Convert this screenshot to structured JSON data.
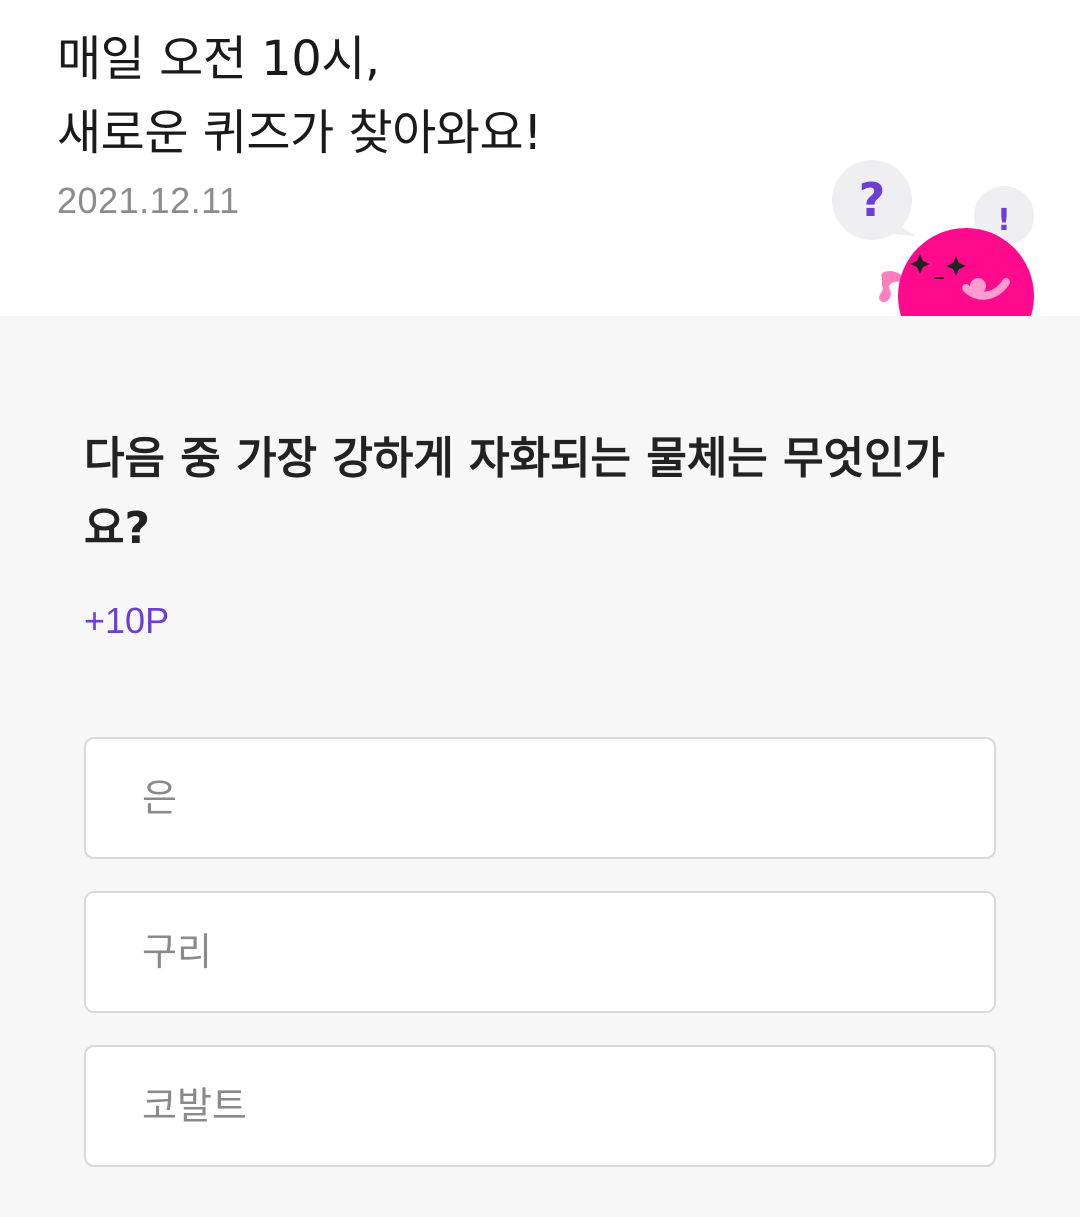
{
  "header": {
    "title_line1": "매일 오전 10시,",
    "title_line2": "새로운 퀴즈가 찾아와요!",
    "date": "2021.12.11",
    "mascot": {
      "bubble_left_symbol": "?",
      "bubble_right_symbol": "!"
    }
  },
  "quiz": {
    "question": "다음 중 가장 강하게 자화되는 물체는 무엇인가요?",
    "points": "+10P",
    "options": [
      {
        "label": "은"
      },
      {
        "label": "구리"
      },
      {
        "label": "코발트"
      }
    ]
  },
  "colors": {
    "accent": "#6b3fd6",
    "mascot_pink": "#ff0a8c",
    "bubble_bg": "#efeff2",
    "page_bg": "#f7f7f7"
  }
}
